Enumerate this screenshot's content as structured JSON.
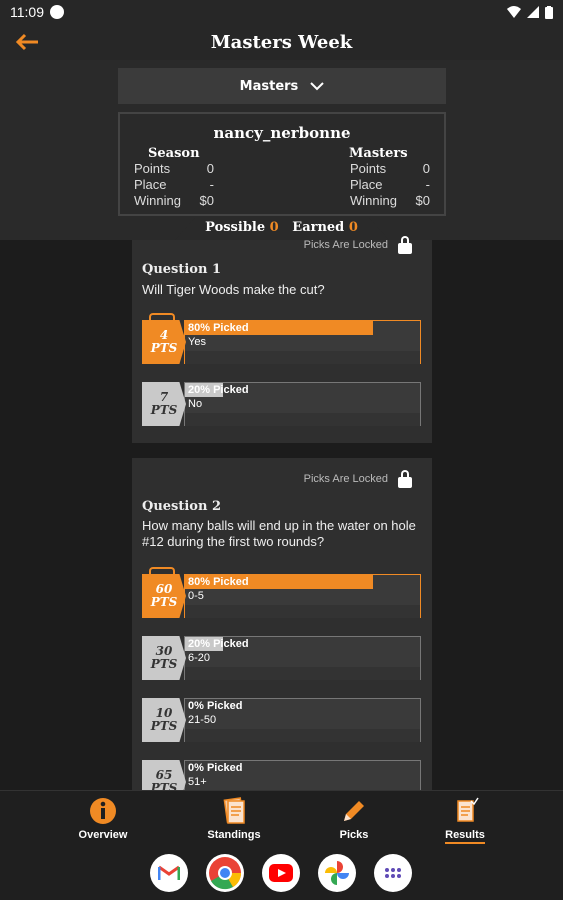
{
  "status_bar": {
    "time": "11:09"
  },
  "app_bar": {
    "title": "Masters Week"
  },
  "dropdown": {
    "selected": "Masters"
  },
  "stats": {
    "user_name": "nancy_nerbonne",
    "season": {
      "heading": "Season",
      "points_label": "Points",
      "points": "0",
      "place_label": "Place",
      "place": "-",
      "winning_label": "Winning",
      "winning": "$0"
    },
    "masters": {
      "heading": "Masters",
      "points_label": "Points",
      "points": "0",
      "place_label": "Place",
      "place": "-",
      "winning_label": "Winning",
      "winning": "$0"
    }
  },
  "totals": {
    "possible_label": "Possible",
    "possible": "0",
    "earned_label": "Earned",
    "earned": "0"
  },
  "questions": [
    {
      "locked_label": "Picks Are Locked",
      "title": "Question 1",
      "text": "Will Tiger Woods make the cut?",
      "options": [
        {
          "pts": "4",
          "pts_unit": "PTS",
          "pct_label": "80% Picked",
          "pct": 80,
          "label": "Yes",
          "selected": true
        },
        {
          "pts": "7",
          "pts_unit": "PTS",
          "pct_label": "20% Picked",
          "pct": 20,
          "label": "No",
          "selected": false
        }
      ]
    },
    {
      "locked_label": "Picks Are Locked",
      "title": "Question 2",
      "text": "How many balls will end up in the water on hole #12 during the first two rounds?",
      "options": [
        {
          "pts": "60",
          "pts_unit": "PTS",
          "pct_label": "80% Picked",
          "pct": 80,
          "label": "0-5",
          "selected": true
        },
        {
          "pts": "30",
          "pts_unit": "PTS",
          "pct_label": "20% Picked",
          "pct": 20,
          "label": "6-20",
          "selected": false
        },
        {
          "pts": "10",
          "pts_unit": "PTS",
          "pct_label": "0% Picked",
          "pct": 0,
          "label": "21-50",
          "selected": false
        },
        {
          "pts": "65",
          "pts_unit": "PTS",
          "pct_label": "0% Picked",
          "pct": 0,
          "label": "51+",
          "selected": false
        }
      ]
    }
  ],
  "bottom_nav": {
    "items": [
      {
        "label": "Overview",
        "icon": "info-icon"
      },
      {
        "label": "Standings",
        "icon": "standings-icon"
      },
      {
        "label": "Picks",
        "icon": "pencil-icon"
      },
      {
        "label": "Results",
        "icon": "results-icon",
        "active": true
      }
    ]
  },
  "dock": {
    "apps": [
      "gmail-icon",
      "chrome-icon",
      "youtube-icon",
      "photos-icon",
      "apps-grid-icon"
    ]
  },
  "colors": {
    "accent": "#f08a24",
    "background": "#1c1c1c",
    "card": "#2f2f2f"
  }
}
